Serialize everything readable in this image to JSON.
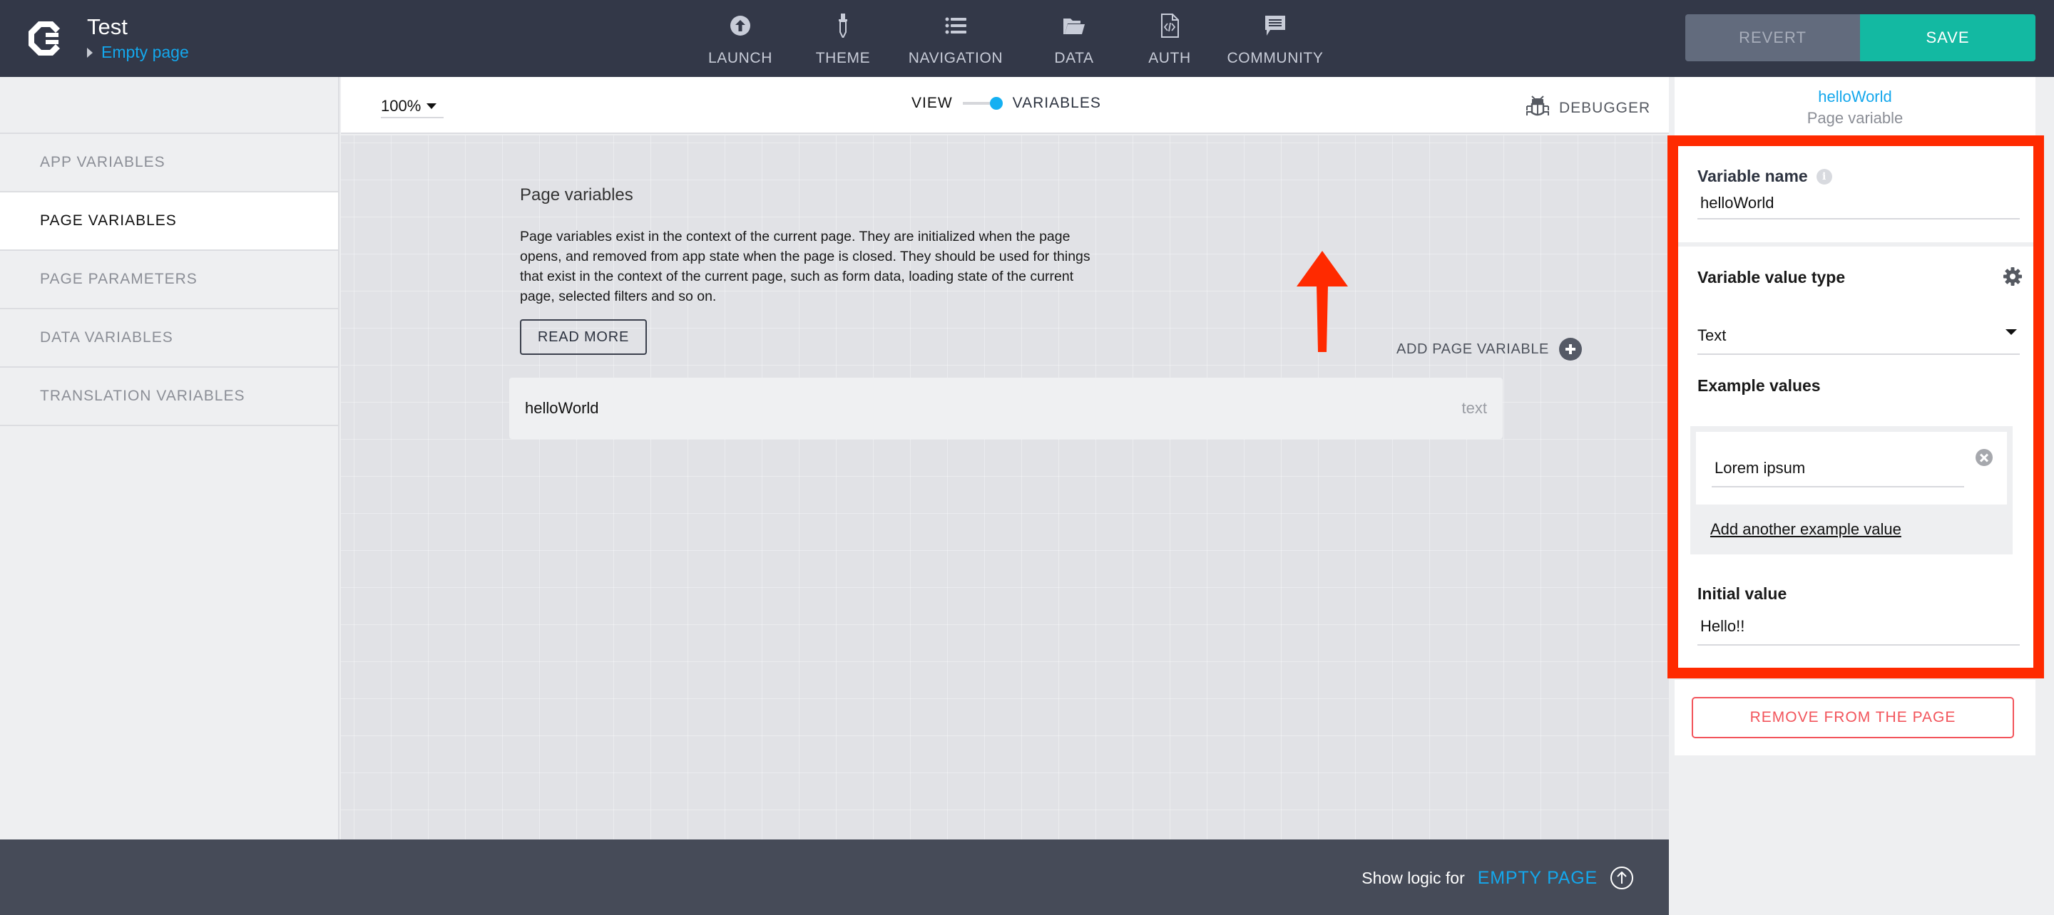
{
  "header": {
    "app_title": "Test",
    "breadcrumb_page": "Empty page",
    "nav": [
      {
        "label": "LAUNCH",
        "icon": "launch-upload-circle-icon"
      },
      {
        "label": "THEME",
        "icon": "eyedropper-icon"
      },
      {
        "label": "NAVIGATION",
        "icon": "list-icon"
      },
      {
        "label": "DATA",
        "icon": "folder-icon"
      },
      {
        "label": "AUTH",
        "icon": "code-file-icon"
      },
      {
        "label": "COMMUNITY",
        "icon": "chat-bubble-icon"
      }
    ],
    "revert_label": "REVERT",
    "save_label": "SAVE"
  },
  "colors": {
    "topbar": "#333848",
    "accent_blue": "#14a7ec",
    "save_green": "#13b9a2",
    "danger_red": "#f2545b",
    "annotation_red": "#ff2a00"
  },
  "sidebar": {
    "items": [
      {
        "label": "APP VARIABLES",
        "active": false
      },
      {
        "label": "PAGE VARIABLES",
        "active": true
      },
      {
        "label": "PAGE PARAMETERS",
        "active": false
      },
      {
        "label": "DATA VARIABLES",
        "active": false
      },
      {
        "label": "TRANSLATION VARIABLES",
        "active": false
      }
    ]
  },
  "toolbar": {
    "zoom_value": "100%",
    "toggle_left": "VIEW",
    "toggle_right": "VARIABLES",
    "toggle_state": "VARIABLES",
    "debugger_label": "DEBUGGER"
  },
  "main": {
    "section_title": "Page variables",
    "description": "Page variables exist in the context of the current page. They are initialized when the page opens, and removed from app state when the page is closed. They should be used for things that exist in the context of the current page, such as form data, loading state of the current page, selected filters and so on.",
    "read_more_label": "READ MORE",
    "add_variable_label": "ADD PAGE VARIABLE",
    "variables": [
      {
        "name": "helloWorld",
        "type": "text"
      }
    ]
  },
  "bottombar": {
    "show_logic_label": "Show logic for",
    "page_name": "EMPTY PAGE"
  },
  "panel": {
    "variable_name_title": "helloWorld",
    "variable_kind": "Page variable",
    "variable_name_label": "Variable name",
    "variable_name_value": "helloWorld",
    "value_type_label": "Variable value type",
    "value_type_selected": "Text",
    "example_values_label": "Example values",
    "example_values": [
      "Lorem ipsum"
    ],
    "add_example_label": "Add another example value",
    "initial_value_label": "Initial value",
    "initial_value": "Hello!!",
    "remove_label": "REMOVE FROM THE PAGE"
  }
}
